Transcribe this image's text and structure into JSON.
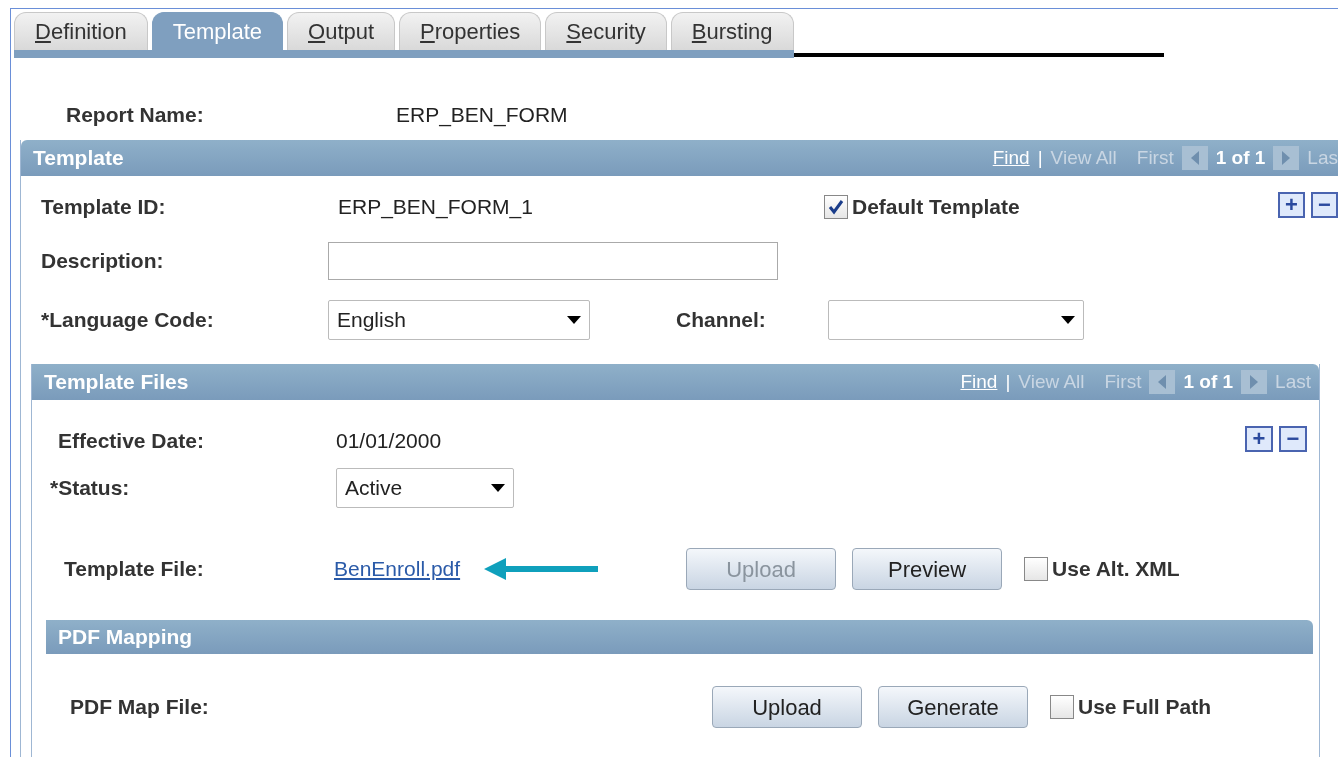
{
  "tabs": [
    {
      "label": "Definition",
      "selected": false
    },
    {
      "label": "Template",
      "selected": true
    },
    {
      "label": "Output",
      "selected": false
    },
    {
      "label": "Properties",
      "selected": false
    },
    {
      "label": "Security",
      "selected": false
    },
    {
      "label": "Bursting",
      "selected": false
    }
  ],
  "report_name": {
    "label": "Report Name:",
    "value": "ERP_BEN_FORM"
  },
  "template": {
    "title": "Template",
    "nav": {
      "find": "Find",
      "separator": "|",
      "view_all": "View All",
      "first": "First",
      "count": "1 of 1",
      "last": "Las"
    },
    "add": "+",
    "remove": "−",
    "template_id": {
      "label": "Template ID:",
      "value": "ERP_BEN_FORM_1"
    },
    "default_template": {
      "label": "Default Template",
      "checked": true
    },
    "description": {
      "label": "Description:"
    },
    "language_code": {
      "label": "*Language Code:",
      "value": "English"
    },
    "channel": {
      "label": "Channel:"
    }
  },
  "template_files": {
    "title": "Template Files",
    "nav": {
      "find": "Find",
      "separator": "|",
      "view_all": "View All",
      "first": "First",
      "count": "1 of 1",
      "last": "Last"
    },
    "add": "+",
    "remove": "−",
    "effective_date": {
      "label": "Effective Date:",
      "value": "01/01/2000"
    },
    "status": {
      "label": "*Status:",
      "value": "Active"
    },
    "template_file": {
      "label": "Template File:",
      "link": "BenEnroll.pdf"
    },
    "template_buttons": [
      {
        "label": "Upload",
        "disabled": true
      },
      {
        "label": "Preview",
        "disabled": false
      }
    ],
    "use_alt_xml": {
      "label": "Use Alt. XML",
      "checked": false
    }
  },
  "pdf_mapping": {
    "title": "PDF Mapping",
    "map_file": {
      "label": "PDF Map File:"
    },
    "buttons": [
      {
        "label": "Upload",
        "disabled": false
      },
      {
        "label": "Generate",
        "disabled": false
      }
    ],
    "use_full_path": {
      "label": "Use Full Path",
      "checked": false
    }
  }
}
